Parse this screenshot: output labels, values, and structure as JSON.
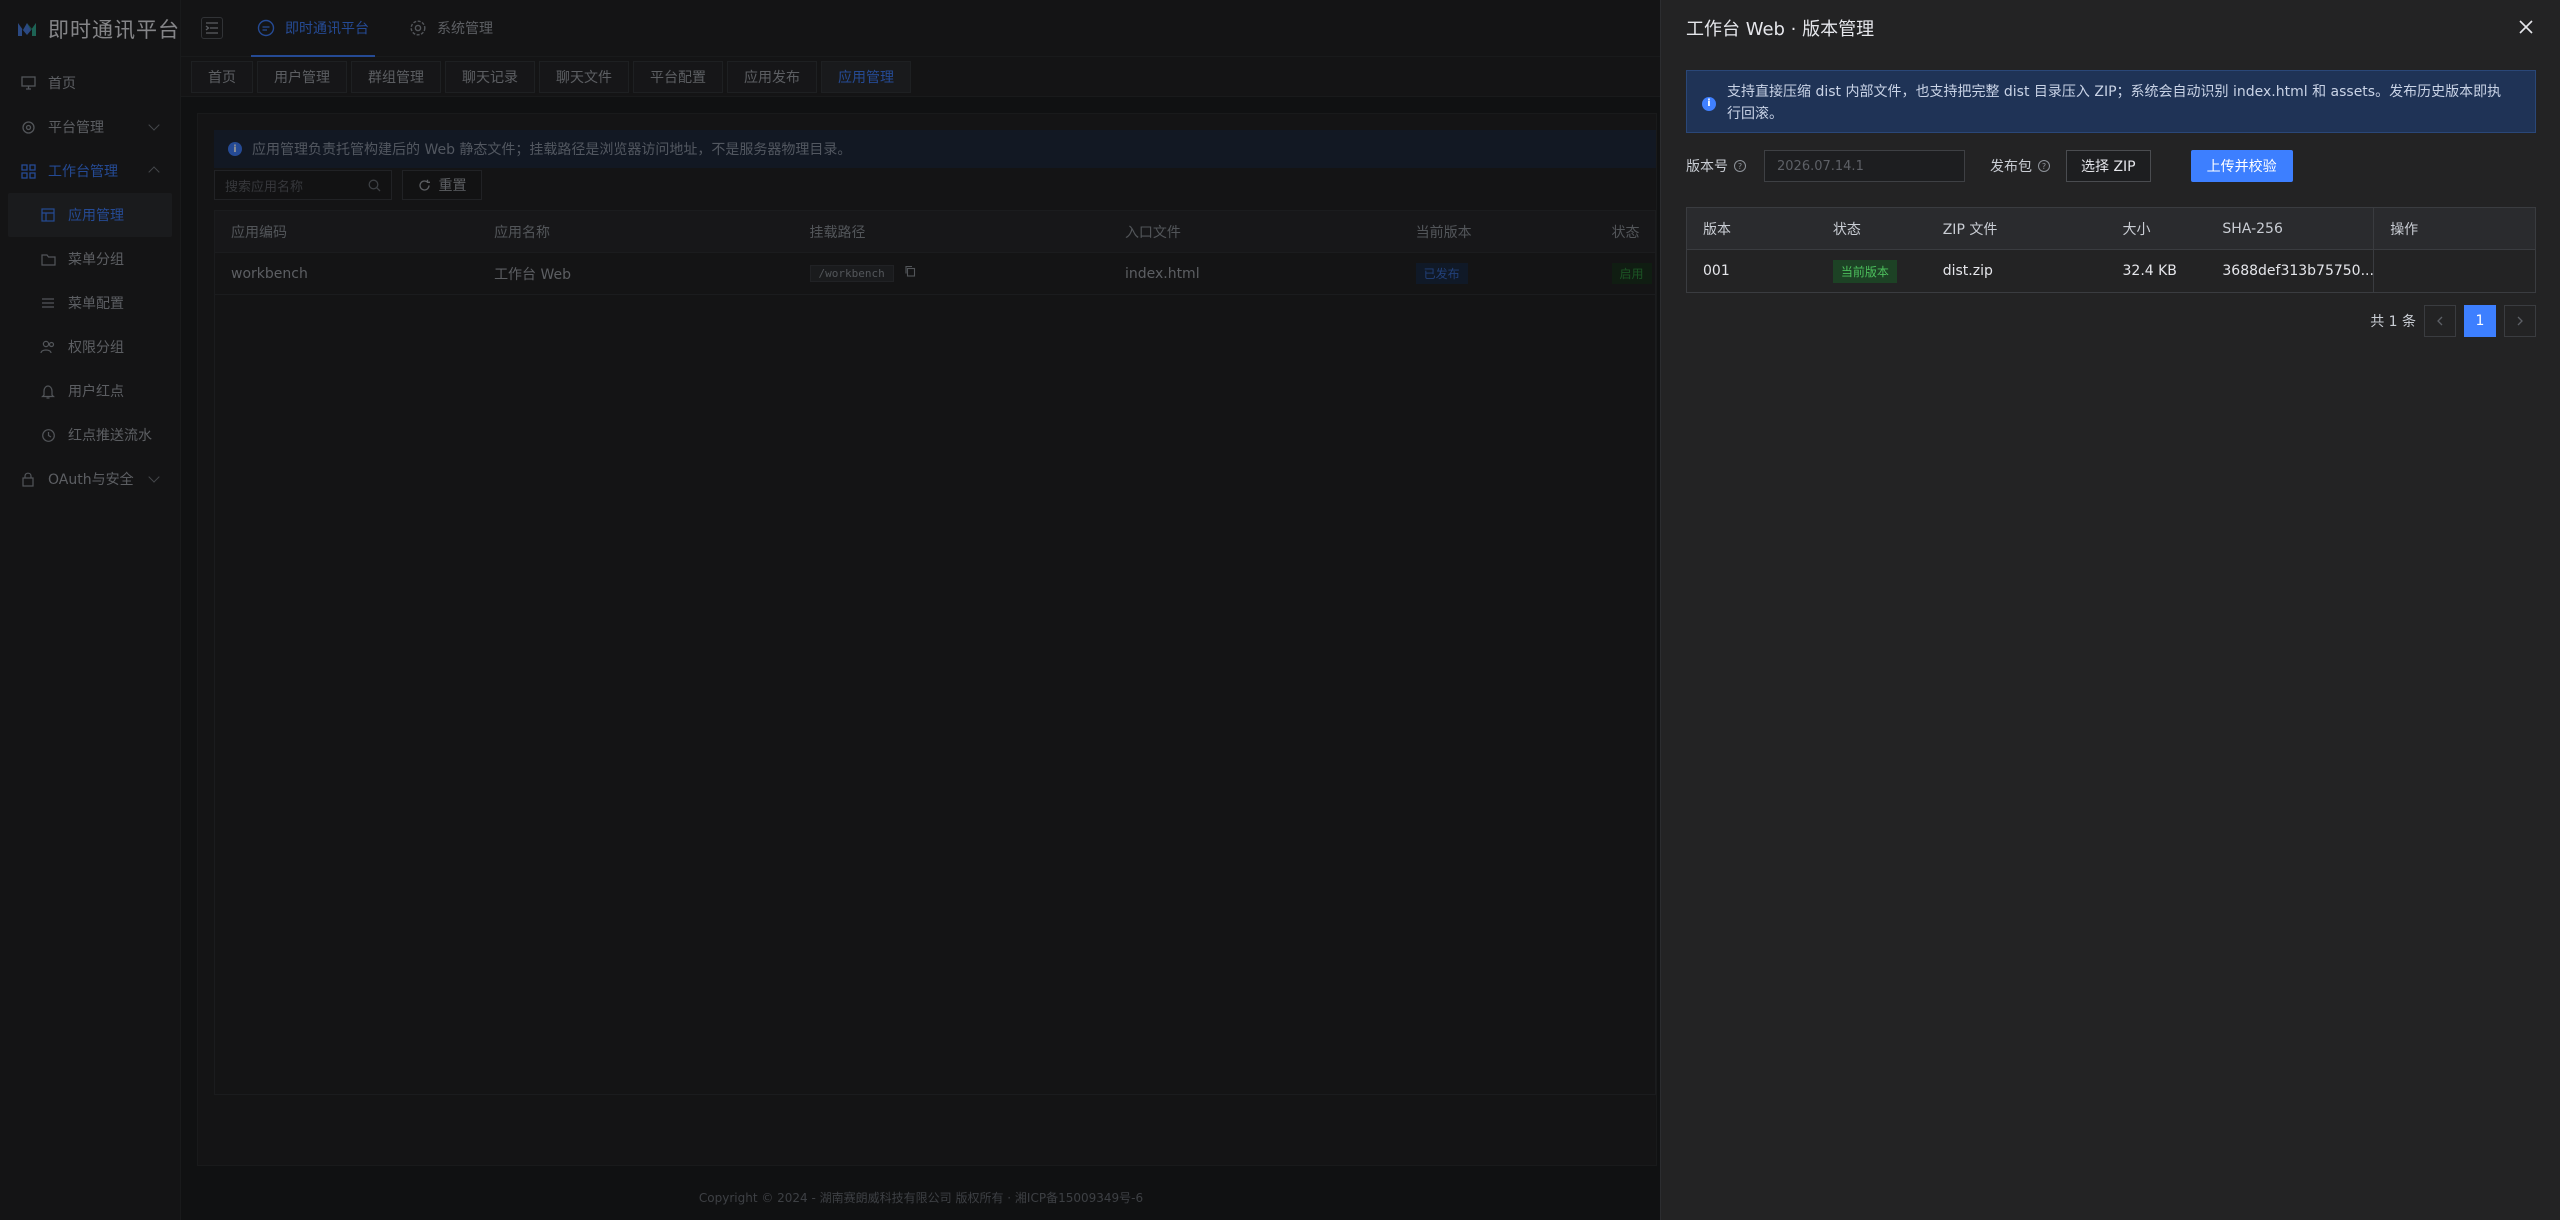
{
  "brand": {
    "title": "即时通讯平台"
  },
  "sidebar": {
    "items": [
      {
        "label": "首页"
      },
      {
        "label": "平台管理"
      },
      {
        "label": "工作台管理"
      },
      {
        "label": "应用管理"
      },
      {
        "label": "菜单分组"
      },
      {
        "label": "菜单配置"
      },
      {
        "label": "权限分组"
      },
      {
        "label": "用户红点"
      },
      {
        "label": "红点推送流水"
      },
      {
        "label": "OAuth与安全"
      }
    ]
  },
  "topbar": {
    "tabs": [
      {
        "label": "即时通讯平台"
      },
      {
        "label": "系统管理"
      }
    ]
  },
  "page_tabs": [
    "首页",
    "用户管理",
    "群组管理",
    "聊天记录",
    "聊天文件",
    "平台配置",
    "应用发布",
    "应用管理"
  ],
  "main": {
    "notice": "应用管理负责托管构建后的 Web 静态文件；挂载路径是浏览器访问地址，不是服务器物理目录。",
    "search_placeholder": "搜索应用名称",
    "reset_label": "重置",
    "columns": [
      "应用编码",
      "应用名称",
      "挂载路径",
      "入口文件",
      "当前版本",
      "状态"
    ],
    "rows": [
      {
        "code": "workbench",
        "name": "工作台 Web",
        "path": "/workbench",
        "entry": "index.html",
        "version": "已发布",
        "status": "启用"
      }
    ]
  },
  "footer": {
    "text": "Copyright © 2024 - 湖南赛朗威科技有限公司 版权所有 · 湘ICP备15009349号-6"
  },
  "drawer": {
    "title": "工作台 Web · 版本管理",
    "alert": "支持直接压缩 dist 内部文件，也支持把完整 dist 目录压入 ZIP；系统会自动识别 index.html 和 assets。发布历史版本即执行回滚。",
    "version_label": "版本号",
    "version_placeholder": "2026.07.14.1",
    "package_label": "发布包",
    "choose_zip": "选择 ZIP",
    "upload_verify": "上传并校验",
    "columns": [
      "版本",
      "状态",
      "ZIP 文件",
      "大小",
      "SHA-256",
      "操作"
    ],
    "rows": [
      {
        "version": "001",
        "status": "当前版本",
        "zip": "dist.zip",
        "size": "32.4 KB",
        "sha": "3688def313b75750..."
      }
    ],
    "pager": {
      "total": "共 1 条",
      "current": "1"
    }
  },
  "colors": {
    "accent": "#3d7fff",
    "success": "#4cbf5c",
    "info_bg": "#1f3356"
  }
}
